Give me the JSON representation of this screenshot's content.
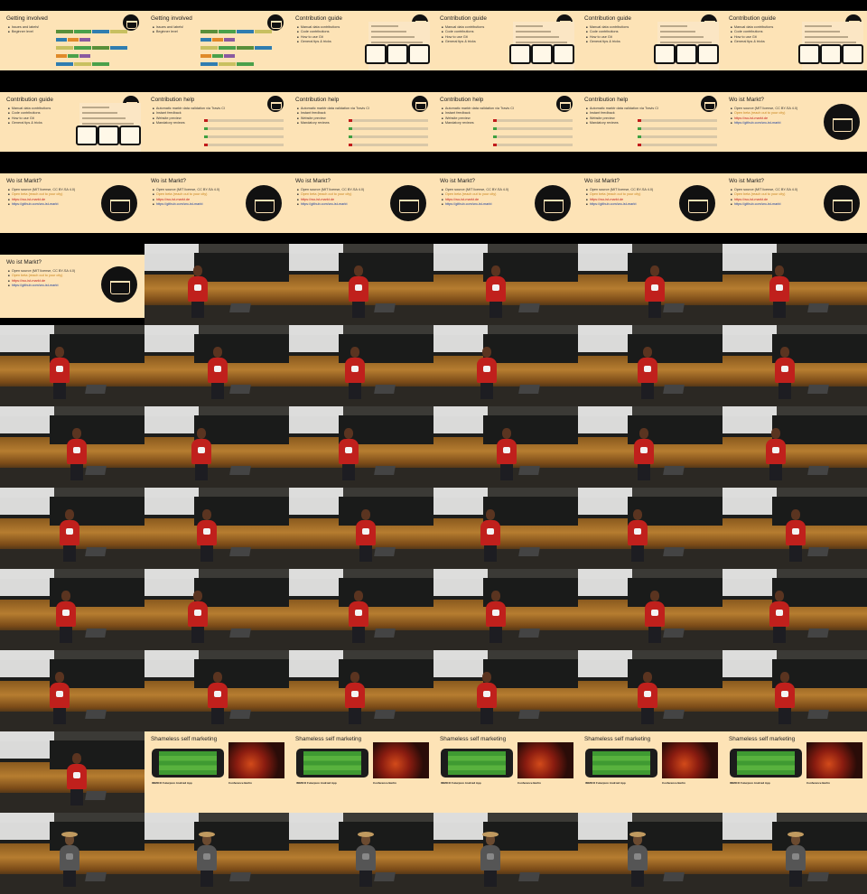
{
  "sheet": {
    "columns": 6,
    "frames": [
      {
        "kind": "slide-bars",
        "title": "Getting involved",
        "bullets": [
          "Issues and labels!",
          "Beginner level"
        ]
      },
      {
        "kind": "slide-bars",
        "title": "Getting involved",
        "bullets": [
          "Issues and labels!",
          "Beginner level"
        ]
      },
      {
        "kind": "slide-guide",
        "title": "Contribution guide",
        "bullets": [
          "Manual data contributions",
          "Code contributions",
          "How to use Git",
          "General tips & tricks"
        ]
      },
      {
        "kind": "slide-guide",
        "title": "Contribution guide",
        "bullets": [
          "Manual data contributions",
          "Code contributions",
          "How to use Git",
          "General tips & tricks"
        ]
      },
      {
        "kind": "slide-guide",
        "title": "Contribution guide",
        "bullets": [
          "Manual data contributions",
          "Code contributions",
          "How to use Git",
          "General tips & tricks"
        ]
      },
      {
        "kind": "slide-guide",
        "title": "Contribution guide",
        "bullets": [
          "Manual data contributions",
          "Code contributions",
          "How to use Git",
          "General tips & tricks"
        ]
      },
      {
        "kind": "slide-guide",
        "title": "Contribution guide",
        "bullets": [
          "Manual data contributions",
          "Code contributions",
          "How to use Git",
          "General tips & tricks"
        ]
      },
      {
        "kind": "slide-help",
        "title": "Contribution help",
        "bullets": [
          "Automatic marktr data validation via Travis CI",
          "Instant feedback",
          "Website preview",
          "Mandatory reviews"
        ]
      },
      {
        "kind": "slide-help",
        "title": "Contribution help",
        "bullets": [
          "Automatic marktr data validation via Travis CI",
          "Instant feedback",
          "Website preview",
          "Mandatory reviews"
        ]
      },
      {
        "kind": "slide-help",
        "title": "Contribution help",
        "bullets": [
          "Automatic marktr data validation via Travis CI",
          "Instant feedback",
          "Website preview",
          "Mandatory reviews"
        ]
      },
      {
        "kind": "slide-help",
        "title": "Contribution help",
        "bullets": [
          "Automatic marktr data validation via Travis CI",
          "Instant feedback",
          "Website preview",
          "Mandatory reviews"
        ]
      },
      {
        "kind": "slide-wo",
        "title": "Wo ist Markt?",
        "bullets": [
          "Open source (MIT license, CC BY-SA 4.0)",
          "Open beta (reach out to your city)",
          "https://wo-ist-markt.de",
          "https://github.com/wo-ist-markt"
        ]
      },
      {
        "kind": "slide-wo",
        "title": "Wo ist Markt?",
        "bullets": [
          "Open source (MIT license, CC BY-SA 4.0)",
          "Open beta (reach out to your city)",
          "https://wo-ist-markt.de",
          "https://github.com/wo-ist-markt"
        ]
      },
      {
        "kind": "slide-wo",
        "title": "Wo ist Markt?",
        "bullets": [
          "Open source (MIT license, CC BY-SA 4.0)",
          "Open beta (reach out to your city)",
          "https://wo-ist-markt.de",
          "https://github.com/wo-ist-markt"
        ]
      },
      {
        "kind": "slide-wo",
        "title": "Wo ist Markt?",
        "bullets": [
          "Open source (MIT license, CC BY-SA 4.0)",
          "Open beta (reach out to your city)",
          "https://wo-ist-markt.de",
          "https://github.com/wo-ist-markt"
        ]
      },
      {
        "kind": "slide-wo",
        "title": "Wo ist Markt?",
        "bullets": [
          "Open source (MIT license, CC BY-SA 4.0)",
          "Open beta (reach out to your city)",
          "https://wo-ist-markt.de",
          "https://github.com/wo-ist-markt"
        ]
      },
      {
        "kind": "slide-wo",
        "title": "Wo ist Markt?",
        "bullets": [
          "Open source (MIT license, CC BY-SA 4.0)",
          "Open beta (reach out to your city)",
          "https://wo-ist-markt.de",
          "https://github.com/wo-ist-markt"
        ]
      },
      {
        "kind": "slide-wo",
        "title": "Wo ist Markt?",
        "bullets": [
          "Open source (MIT license, CC BY-SA 4.0)",
          "Open beta (reach out to your city)",
          "https://wo-ist-markt.de",
          "https://github.com/wo-ist-markt"
        ]
      },
      {
        "kind": "slide-wo",
        "title": "Wo ist Markt?",
        "bullets": [
          "Open source (MIT license, CC BY-SA 4.0)",
          "Open beta (reach out to your city)",
          "https://wo-ist-markt.de",
          "https://github.com/wo-ist-markt"
        ]
      },
      {
        "kind": "photo"
      },
      {
        "kind": "photo"
      },
      {
        "kind": "photo"
      },
      {
        "kind": "photo"
      },
      {
        "kind": "photo"
      },
      {
        "kind": "photo"
      },
      {
        "kind": "photo"
      },
      {
        "kind": "photo"
      },
      {
        "kind": "photo"
      },
      {
        "kind": "photo"
      },
      {
        "kind": "photo"
      },
      {
        "kind": "photo"
      },
      {
        "kind": "photo"
      },
      {
        "kind": "photo"
      },
      {
        "kind": "photo"
      },
      {
        "kind": "photo"
      },
      {
        "kind": "photo"
      },
      {
        "kind": "photo"
      },
      {
        "kind": "photo"
      },
      {
        "kind": "photo"
      },
      {
        "kind": "photo"
      },
      {
        "kind": "photo"
      },
      {
        "kind": "photo"
      },
      {
        "kind": "photo"
      },
      {
        "kind": "photo"
      },
      {
        "kind": "photo"
      },
      {
        "kind": "photo"
      },
      {
        "kind": "photo"
      },
      {
        "kind": "photo"
      },
      {
        "kind": "photo"
      },
      {
        "kind": "photo"
      },
      {
        "kind": "photo"
      },
      {
        "kind": "photo"
      },
      {
        "kind": "photo"
      },
      {
        "kind": "photo"
      },
      {
        "kind": "photo"
      },
      {
        "kind": "slide-market",
        "title": "Shameless self marketing",
        "app": "IMMICO Futurpion Android App",
        "event": "Conference Berlin"
      },
      {
        "kind": "slide-market",
        "title": "Shameless self marketing",
        "app": "IMMICO Futurpion Android App",
        "event": "Conference Berlin"
      },
      {
        "kind": "slide-market",
        "title": "Shameless self marketing",
        "app": "IMMICO Futurpion Android App",
        "event": "Conference Berlin"
      },
      {
        "kind": "slide-market",
        "title": "Shameless self marketing",
        "app": "IMMICO Futurpion Android App",
        "event": "Conference Berlin"
      },
      {
        "kind": "slide-market",
        "title": "Shameless self marketing",
        "app": "IMMICO Futurpion Android App",
        "event": "Conference Berlin"
      },
      {
        "kind": "photo-hat"
      },
      {
        "kind": "photo-hat"
      },
      {
        "kind": "photo-hat"
      },
      {
        "kind": "photo-hat"
      },
      {
        "kind": "photo-hat"
      },
      {
        "kind": "photo-hat"
      }
    ]
  }
}
